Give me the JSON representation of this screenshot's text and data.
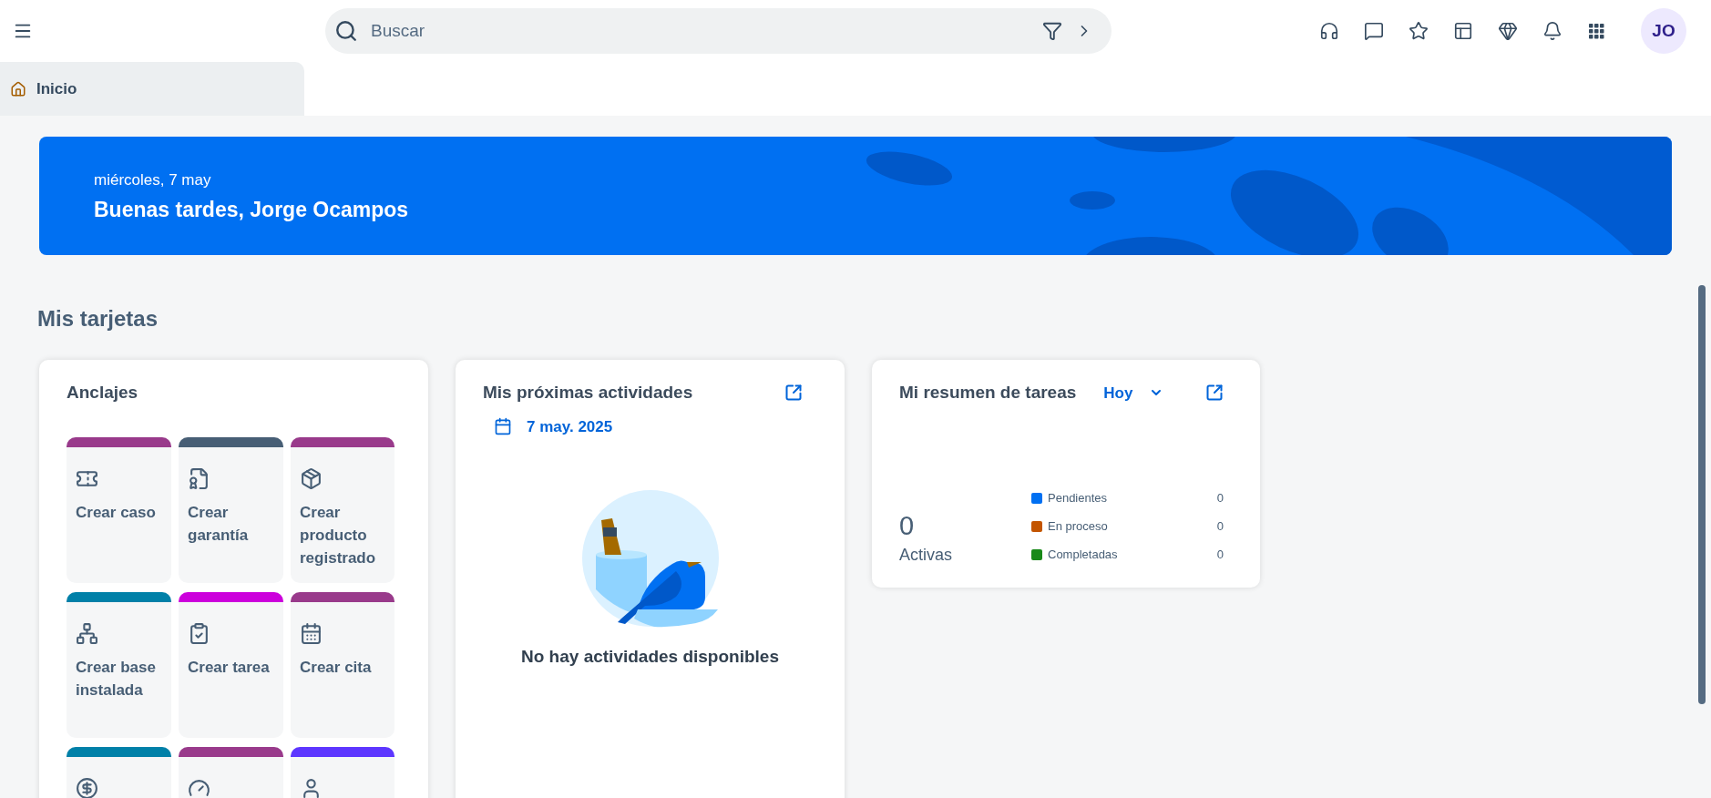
{
  "header": {
    "search": {
      "placeholder": "Buscar"
    },
    "avatar": "JO"
  },
  "tabs": [
    {
      "label": "Inicio",
      "selected": true
    }
  ],
  "banner": {
    "date": "miércoles, 7 may",
    "greeting": "Buenas tardes, Jorge Ocampos"
  },
  "section_title": "Mis tarjetas",
  "anchors_card": {
    "title": "Anclajes",
    "tiles": [
      {
        "label": "Crear caso",
        "color": "#993a8b"
      },
      {
        "label": "Crear garantía",
        "color": "#475e75"
      },
      {
        "label": "Crear producto registrado",
        "color": "#993a8b"
      },
      {
        "label": "Crear base instalada",
        "color": "#0080a8"
      },
      {
        "label": "Crear tarea",
        "color": "#cc00dc"
      },
      {
        "label": "Crear cita",
        "color": "#993a8b"
      },
      {
        "color": "#0080a8"
      },
      {
        "color": "#993a8b"
      },
      {
        "color": "#5d36ff"
      }
    ]
  },
  "activities_card": {
    "title": "Mis próximas actividades",
    "date": "7 may. 2025",
    "empty_text": "No hay actividades disponibles"
  },
  "tasks_card": {
    "title": "Mi resumen de tareas",
    "filter": "Hoy",
    "active_count": "0",
    "active_label": "Activas",
    "legend": [
      {
        "label": "Pendientes",
        "color": "#0070f2",
        "value": "0"
      },
      {
        "label": "En proceso",
        "color": "#c35500",
        "value": "0"
      },
      {
        "label": "Completadas",
        "color": "#188918",
        "value": "0"
      }
    ]
  }
}
